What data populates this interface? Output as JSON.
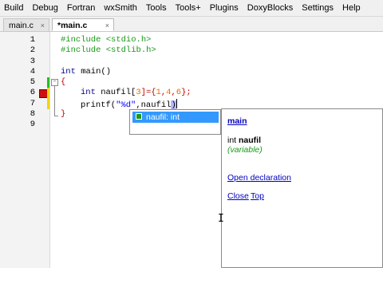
{
  "menu": {
    "items": [
      "Build",
      "Debug",
      "Fortran",
      "wxSmith",
      "Tools",
      "Tools+",
      "Plugins",
      "DoxyBlocks",
      "Settings",
      "Help"
    ]
  },
  "tabs": {
    "inactive_label": "main.c",
    "active_label": "*main.c",
    "close_glyph": "×"
  },
  "editor": {
    "line_numbers": [
      "1",
      "2",
      "3",
      "4",
      "5",
      "6",
      "7",
      "8",
      "9"
    ],
    "lines": {
      "l1": {
        "pp": "#include ",
        "rest": "<stdio.h>"
      },
      "l2": {
        "pp": "#include ",
        "rest": "<stdlib.h>"
      },
      "l4": {
        "kw": "int",
        "rest": " main()"
      },
      "l5": {
        "brace": "{"
      },
      "l6": {
        "kw": "int",
        "a": " naufil[",
        "n1": "3",
        "b": "]={",
        "n2": "1",
        "c": ",",
        "n3": "4",
        "d": ",",
        "n4": "6",
        "e": "};"
      },
      "l7": {
        "a": "printf(",
        "str": "\"%d\"",
        "b": ",naufil",
        "c": ")"
      },
      "l8": {
        "brace": "}"
      }
    },
    "fold_glyph": "−"
  },
  "autocomplete": {
    "selected_item": "naufil: int"
  },
  "doc_panel": {
    "title": "main",
    "sig_type": "int ",
    "sig_name": "naufil",
    "kind": "(variable)",
    "open_declaration": "Open declaration",
    "close": "Close",
    "top": "Top"
  },
  "colors": {
    "preprocessor": "#1a9a1a",
    "keyword": "#00008b",
    "number": "#e46d00",
    "string": "#0000ff",
    "selection": "#3399ff",
    "error_marker": "#cc1111",
    "changed_saved": "#22c022",
    "changed_unsaved": "#f2d600"
  },
  "icons": {
    "autocomplete_item_icon": "variable-icon",
    "mouse_cursor": "text-cursor-icon",
    "breakpoint_marker": "error-marker-icon"
  }
}
